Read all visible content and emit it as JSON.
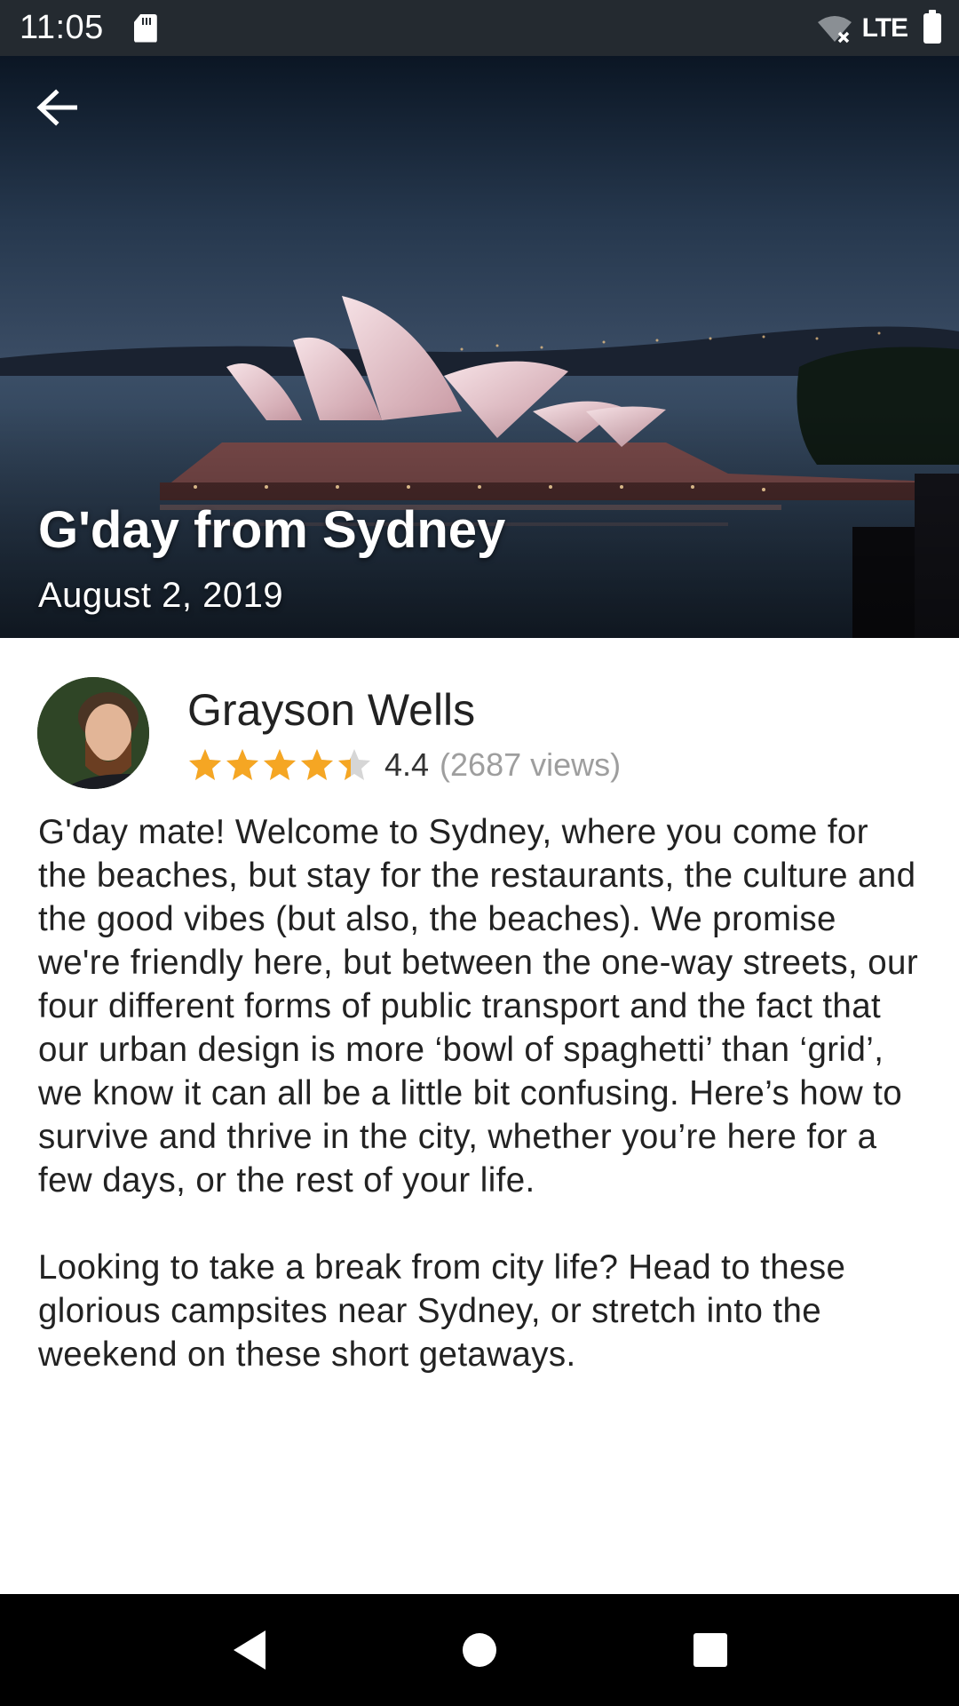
{
  "status_bar": {
    "time": "11:05",
    "network": "LTE",
    "icons": [
      "sd-card-icon",
      "wifi-off-icon",
      "battery-icon"
    ]
  },
  "hero": {
    "title": "G'day from Sydney",
    "date": "August 2, 2019",
    "back_icon": "arrow-back-icon"
  },
  "author": {
    "name": "Grayson Wells",
    "rating": 4.4,
    "rating_text": "4.4",
    "max_stars": 5,
    "views_text": "(2687 views)",
    "star_color": "#f5a623",
    "star_empty_color": "#d6d6d6"
  },
  "article": {
    "paragraphs": [
      "G'day mate! Welcome to Sydney, where you come for the beaches, but stay for the restaurants, the culture and the good vibes (but also, the beaches). We promise we're friendly here, but between the one-way streets, our four different forms of public transport and the fact that our urban design is more ‘bowl of spaghetti’ than ‘grid’, we know it can all be a little bit confusing. Here’s how to survive and thrive in the city, whether you’re here for a few days, or the rest of your life.",
      "Looking to take a break from city life? Head to these glorious campsites near Sydney, or stretch into the weekend on these short getaways."
    ]
  },
  "nav_bar": {
    "icons": [
      "back-triangle-icon",
      "home-circle-icon",
      "recents-square-icon"
    ]
  }
}
